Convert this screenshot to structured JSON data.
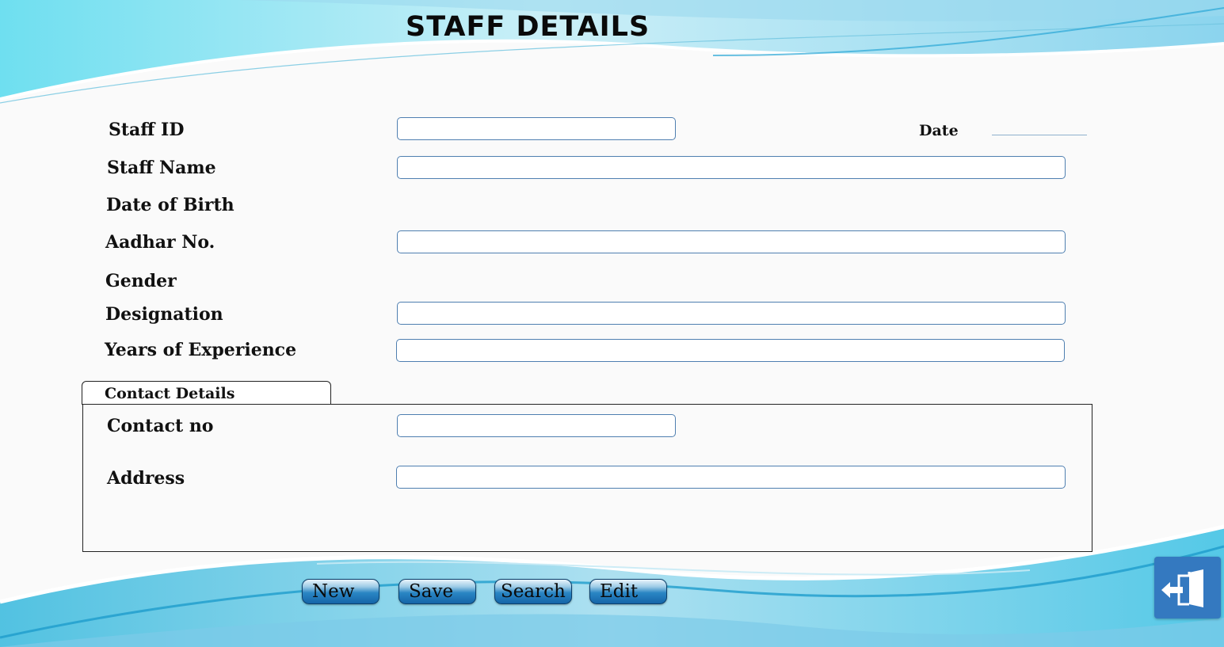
{
  "title": "STAFF DETAILS",
  "form": {
    "staff_id": {
      "label": "Staff ID",
      "value": ""
    },
    "date": {
      "label": "Date",
      "value": ""
    },
    "staff_name": {
      "label": "Staff Name",
      "value": ""
    },
    "date_of_birth": {
      "label": "Date of Birth"
    },
    "aadhar_no": {
      "label": "Aadhar No.",
      "value": ""
    },
    "gender": {
      "label": "Gender"
    },
    "designation": {
      "label": "Designation",
      "value": ""
    },
    "years_of_experience": {
      "label": "Years of Experience",
      "value": ""
    }
  },
  "contact": {
    "tab_label": "Contact Details",
    "contact_no": {
      "label": "Contact no",
      "value": ""
    },
    "address": {
      "label": "Address",
      "value": ""
    }
  },
  "buttons": {
    "new": "New",
    "save": "Save",
    "search": "Search",
    "edit": "Edit"
  },
  "exit_icon": "exit-door-icon",
  "colors": {
    "field_border": "#4f7fb0",
    "button_blue": "#1565a8",
    "exit_blue": "#3479c0",
    "wave_light": "#8fd9ec"
  }
}
